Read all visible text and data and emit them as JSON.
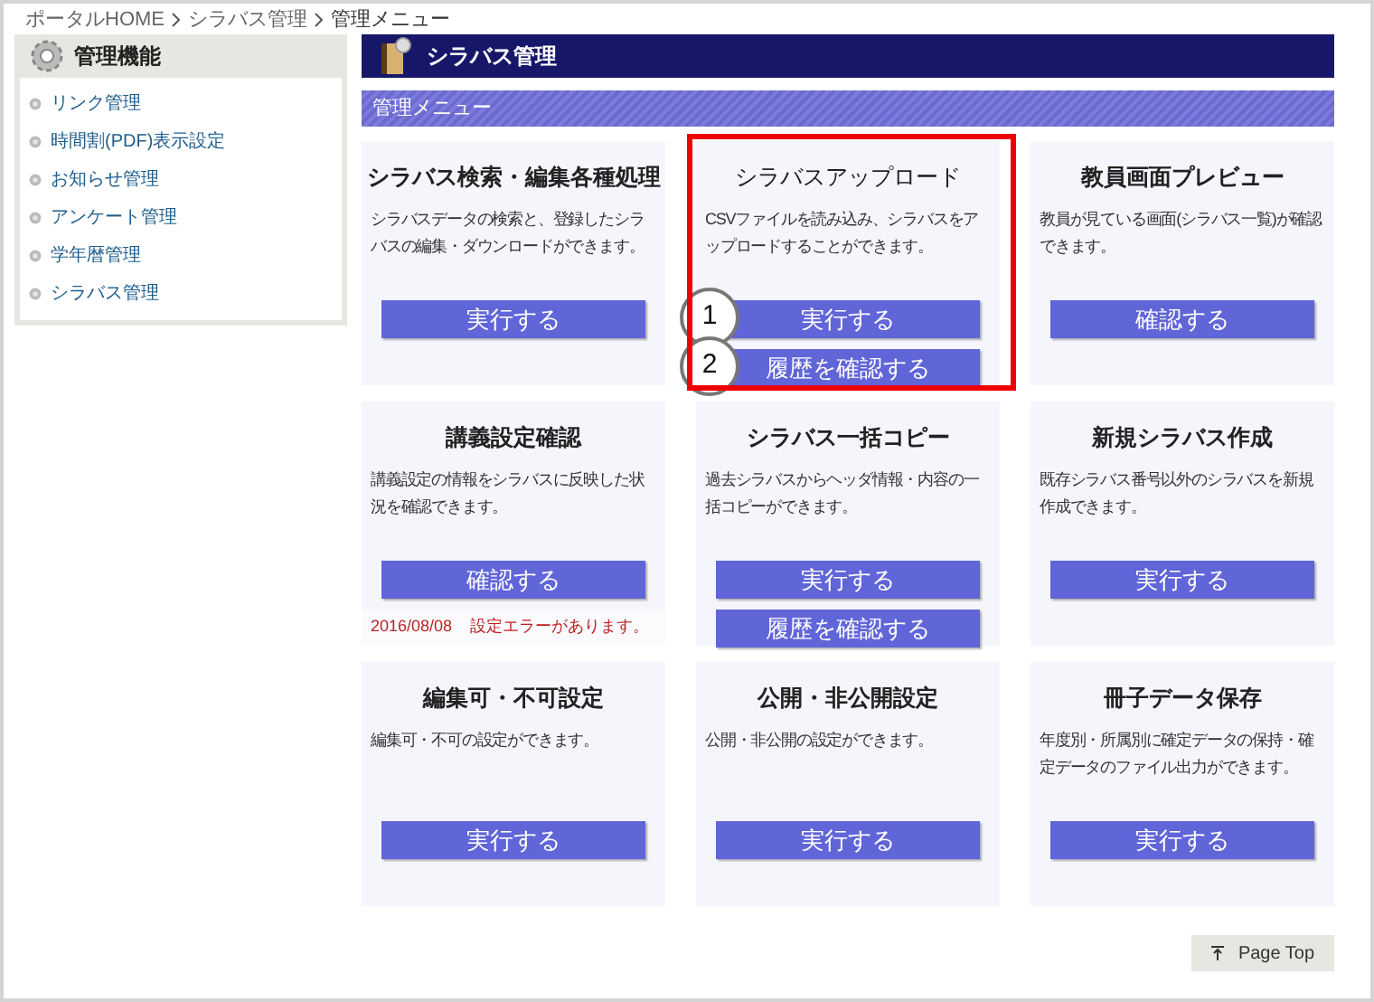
{
  "breadcrumb": [
    "ポータルHOME",
    "シラバス管理",
    "管理メニュー"
  ],
  "sidebar": {
    "title": "管理機能",
    "items": [
      {
        "label": "リンク管理"
      },
      {
        "label": "時間割(PDF)表示設定"
      },
      {
        "label": "お知らせ管理"
      },
      {
        "label": "アンケート管理"
      },
      {
        "label": "学年暦管理"
      },
      {
        "label": "シラバス管理"
      }
    ]
  },
  "header": {
    "title": "シラバス管理"
  },
  "section": {
    "title": "管理メニュー"
  },
  "cards": [
    {
      "title": "シラバス検索・編集各種処理",
      "description": "シラバスデータの検索と、登録したシラバスの編集・ダウンロードができます。",
      "highlighted": false,
      "buttons": [
        {
          "label": "実行する"
        }
      ]
    },
    {
      "title": "シラバスアップロード",
      "description": "CSVファイルを読み込み、シラバスをアップロードすることができます。",
      "highlighted": true,
      "buttons": [
        {
          "label": "実行する",
          "callout": "1"
        },
        {
          "label": "履歴を確認する",
          "callout": "2"
        }
      ]
    },
    {
      "title": "教員画面プレビュー",
      "description": "教員が見ている画面(シラバス一覧)が確認できます。",
      "highlighted": false,
      "buttons": [
        {
          "label": "確認する"
        }
      ]
    },
    {
      "title": "講義設定確認",
      "description": "講義設定の情報をシラバスに反映した状況を確認できます。",
      "highlighted": false,
      "buttons": [
        {
          "label": "確認する"
        }
      ],
      "notice": {
        "date": "2016/08/08",
        "message": "設定エラーがあります。"
      }
    },
    {
      "title": "シラバス一括コピー",
      "description": "過去シラバスからヘッダ情報・内容の一括コピーができます。",
      "highlighted": false,
      "buttons": [
        {
          "label": "実行する"
        },
        {
          "label": "履歴を確認する"
        }
      ]
    },
    {
      "title": "新規シラバス作成",
      "description": "既存シラバス番号以外のシラバスを新規作成できます。",
      "highlighted": false,
      "buttons": [
        {
          "label": "実行する"
        }
      ]
    },
    {
      "title": "編集可・不可設定",
      "description": "編集可・不可の設定ができます。",
      "highlighted": false,
      "buttons": [
        {
          "label": "実行する"
        }
      ]
    },
    {
      "title": "公開・非公開設定",
      "description": "公開・非公開の設定ができます。",
      "highlighted": false,
      "buttons": [
        {
          "label": "実行する"
        }
      ]
    },
    {
      "title": "冊子データ保存",
      "description": "年度別・所属別に確定データの保持・確定データのファイル出力ができます。",
      "highlighted": false,
      "buttons": [
        {
          "label": "実行する"
        }
      ]
    }
  ],
  "page_top": {
    "label": "Page Top"
  }
}
